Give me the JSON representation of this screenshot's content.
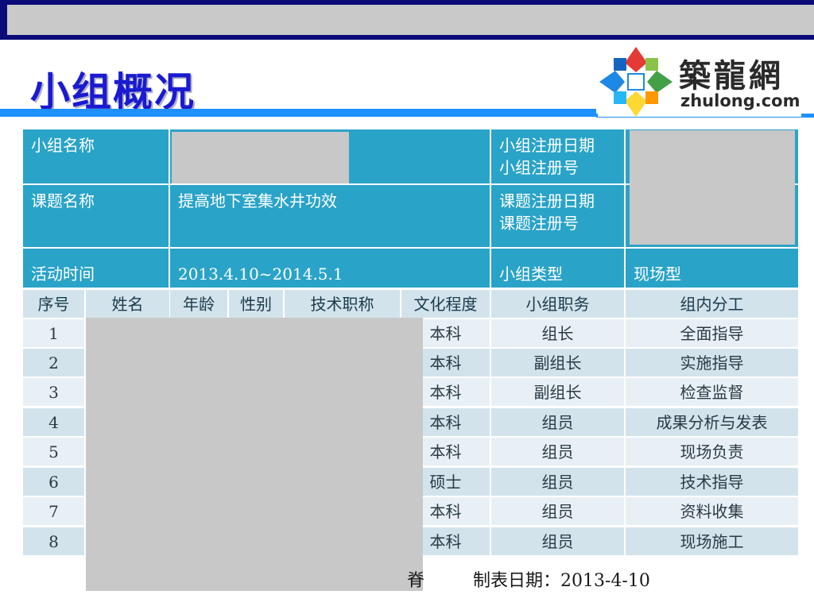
{
  "title": "小组概况",
  "logo": {
    "cn": "築龍網",
    "en": "zhulong.com"
  },
  "info": {
    "group_name_label": "小组名称",
    "group_reg_label": [
      "小组注册日期",
      "小组注册号"
    ],
    "topic_label": "课题名称",
    "topic_value": "提高地下室集水井功效",
    "topic_reg_label": [
      "课题注册日期",
      "课题注册号"
    ],
    "activity_label": "活动时间",
    "activity_value": "2013.4.10~2014.5.1",
    "type_label": "小组类型",
    "type_value": "现场型"
  },
  "table": {
    "headers": [
      "序号",
      "姓名",
      "年龄",
      "性别",
      "技术职称",
      "文化程度",
      "小组职务",
      "组内分工"
    ],
    "rows": [
      {
        "no": "1",
        "edu": "本科",
        "role": "组长",
        "duty": "全面指导"
      },
      {
        "no": "2",
        "edu": "本科",
        "role": "副组长",
        "duty": "实施指导"
      },
      {
        "no": "3",
        "edu": "本科",
        "role": "副组长",
        "duty": "检查监督"
      },
      {
        "no": "4",
        "edu": "本科",
        "role": "组员",
        "duty": "成果分析与发表"
      },
      {
        "no": "5",
        "edu": "本科",
        "role": "组员",
        "duty": "现场负责"
      },
      {
        "no": "6",
        "edu": "硕士",
        "role": "组员",
        "duty": "技术指导"
      },
      {
        "no": "7",
        "edu": "本科",
        "role": "组员",
        "duty": "资料收集"
      },
      {
        "no": "8",
        "edu": "本科",
        "role": "组员",
        "duty": "现场施工"
      }
    ]
  },
  "footer": {
    "partial": "脊",
    "date": "制表日期：2013-4-10"
  },
  "colors": {
    "title": "#1a1ad0",
    "teal": "#2aa3c8",
    "rule": "#1e90ff",
    "topbar": "#0b0b7a"
  }
}
